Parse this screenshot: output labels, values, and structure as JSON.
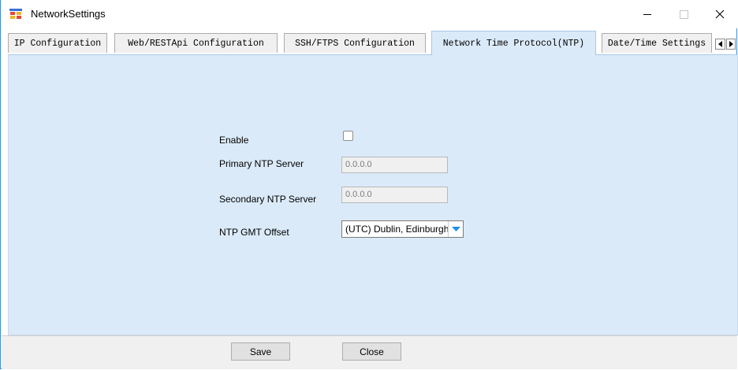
{
  "window": {
    "title": "NetworkSettings",
    "app_icon": "network-app-icon",
    "controls": {
      "minimize": "minimize-icon",
      "maximize": "maximize-icon",
      "close": "close-icon"
    }
  },
  "tabs": [
    {
      "label": "IP Configuration",
      "active": false
    },
    {
      "label": "Web/RESTApi Configuration",
      "active": false
    },
    {
      "label": "SSH/FTPS Configuration",
      "active": false
    },
    {
      "label": "Network Time Protocol(NTP)",
      "active": true
    },
    {
      "label": "Date/Time Settings",
      "active": false
    }
  ],
  "tab_scroll": {
    "left": "arrow-left-icon",
    "right": "arrow-right-icon"
  },
  "ntp": {
    "enable_label": "Enable",
    "enable_checked": false,
    "primary_label": "Primary NTP Server",
    "primary_value": "0.0.0.0",
    "secondary_label": "Secondary NTP Server",
    "secondary_value": "0.0.0.0",
    "offset_label": "NTP GMT Offset",
    "offset_value": "(UTC) Dublin, Edinburgh,"
  },
  "footer": {
    "save_label": "Save",
    "close_label": "Close"
  },
  "colors": {
    "panel": "#dbeaf9",
    "window_border": "#3c8fd6",
    "dropdown_arrow": "#1e90e6"
  }
}
